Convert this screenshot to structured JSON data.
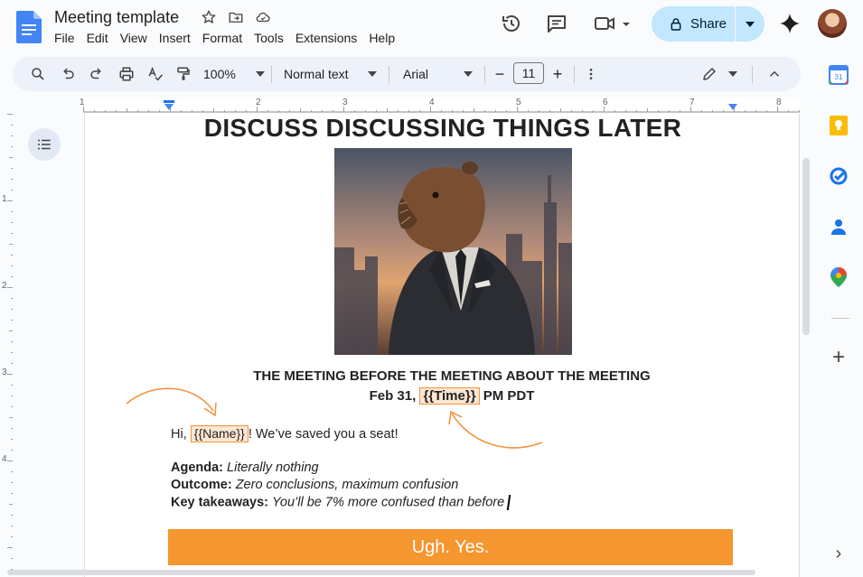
{
  "app": {
    "doc_title": "Meeting template",
    "menu": [
      "File",
      "Edit",
      "View",
      "Insert",
      "Format",
      "Tools",
      "Extensions",
      "Help"
    ],
    "share_label": "Share"
  },
  "toolbar": {
    "zoom": "100%",
    "style": "Normal text",
    "font": "Arial",
    "font_size": "11",
    "minus": "−",
    "plus": "+"
  },
  "ruler": {
    "h_numbers": [
      "1",
      "1",
      "2",
      "3",
      "4",
      "5",
      "6",
      "7"
    ],
    "v_numbers": [
      "1",
      "1",
      "2",
      "3",
      "4"
    ]
  },
  "document": {
    "heading": "DISCUSS DISCUSSING THINGS LATER",
    "subheading": "THE MEETING BEFORE THE MEETING ABOUT THE MEETING",
    "date_prefix": "Feb 31,",
    "time_token": "{{Time}}",
    "date_suffix": "PM PDT",
    "greeting_prefix": "Hi,",
    "name_token": "{{Name}}",
    "greeting_suffix": "! We’ve saved you a seat!",
    "agenda_label": "Agenda:",
    "agenda_value": "Literally nothing",
    "outcome_label": "Outcome:",
    "outcome_value": "Zero conclusions, maximum confusion",
    "takeaways_label": "Key takeaways:",
    "takeaways_value": "You’ll be 7% more confused than before",
    "cta_label": "Ugh. Yes."
  },
  "side_panel": {
    "calendar_day": "31",
    "add": "+",
    "expand": "›"
  },
  "colors": {
    "accent_orange": "#f5962f",
    "token_border": "#f09440",
    "token_fill": "#fde6d2",
    "share_bg": "#c2e7ff",
    "toolbar_bg": "#edf2fa"
  },
  "icons": [
    "docs-logo-icon",
    "star-icon",
    "move-folder-icon",
    "cloud-saved-icon",
    "history-icon",
    "comments-icon",
    "meet-icon",
    "lock-icon",
    "gemini-icon",
    "search-icon",
    "undo-icon",
    "redo-icon",
    "print-icon",
    "spellcheck-icon",
    "paint-format-icon",
    "more-icon",
    "edit-mode-icon",
    "collapse-icon",
    "outline-icon",
    "calendar-icon",
    "keep-icon",
    "tasks-icon",
    "contacts-icon",
    "maps-icon",
    "plus-icon",
    "chevron-right-icon"
  ]
}
